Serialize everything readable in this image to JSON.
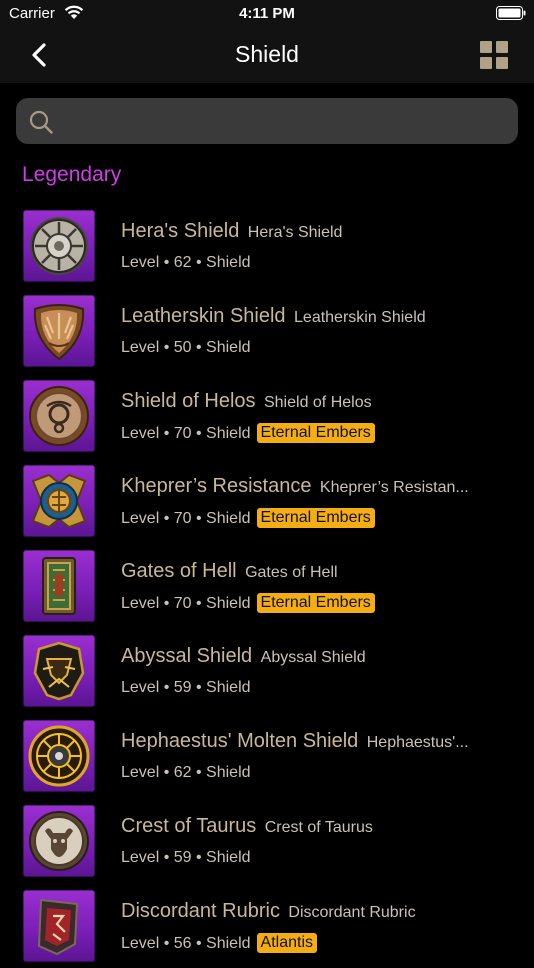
{
  "status": {
    "carrier": "Carrier",
    "time": "4:11 PM"
  },
  "nav": {
    "title": "Shield"
  },
  "search": {
    "placeholder": ""
  },
  "section": {
    "title": "Legendary"
  },
  "colors": {
    "accent": "#d03ce8",
    "name": "#c9b896",
    "tag_bg": "#f5ad14",
    "thumb_bg": "#8a27c4"
  },
  "items": [
    {
      "name": "Hera's Shield",
      "alt": "Hera's Shield",
      "level_label": "Level",
      "level": "62",
      "type": "Shield",
      "tag": "",
      "icon": "round-silver-shield-icon"
    },
    {
      "name": "Leatherskin Shield",
      "alt": "Leatherskin Shield",
      "level_label": "Level",
      "level": "50",
      "type": "Shield",
      "tag": "",
      "icon": "leather-shield-icon"
    },
    {
      "name": "Shield of Helos",
      "alt": "Shield of Helos",
      "level_label": "Level",
      "level": "70",
      "type": "Shield",
      "tag": "Eternal Embers",
      "icon": "bronze-round-shield-icon"
    },
    {
      "name": "Kheprer’s Resistance",
      "alt": "Kheprer’s Resistan...",
      "level_label": "Level",
      "level": "70",
      "type": "Shield",
      "tag": "Eternal Embers",
      "icon": "scarab-shield-icon"
    },
    {
      "name": "Gates of Hell",
      "alt": "Gates of Hell",
      "level_label": "Level",
      "level": "70",
      "type": "Shield",
      "tag": "Eternal Embers",
      "icon": "tower-shield-icon"
    },
    {
      "name": "Abyssal Shield",
      "alt": "Abyssal Shield",
      "level_label": "Level",
      "level": "59",
      "type": "Shield",
      "tag": "",
      "icon": "dark-spiked-shield-icon"
    },
    {
      "name": "Hephaestus' Molten Shield",
      "alt": "Hephaestus'...",
      "level_label": "Level",
      "level": "62",
      "type": "Shield",
      "tag": "",
      "icon": "molten-shield-icon"
    },
    {
      "name": "Crest of Taurus",
      "alt": "Crest of Taurus",
      "level_label": "Level",
      "level": "59",
      "type": "Shield",
      "tag": "",
      "icon": "bull-crest-shield-icon"
    },
    {
      "name": "Discordant Rubric",
      "alt": "Discordant Rubric",
      "level_label": "Level",
      "level": "56",
      "type": "Shield",
      "tag": "Atlantis",
      "icon": "rune-shield-icon"
    }
  ]
}
